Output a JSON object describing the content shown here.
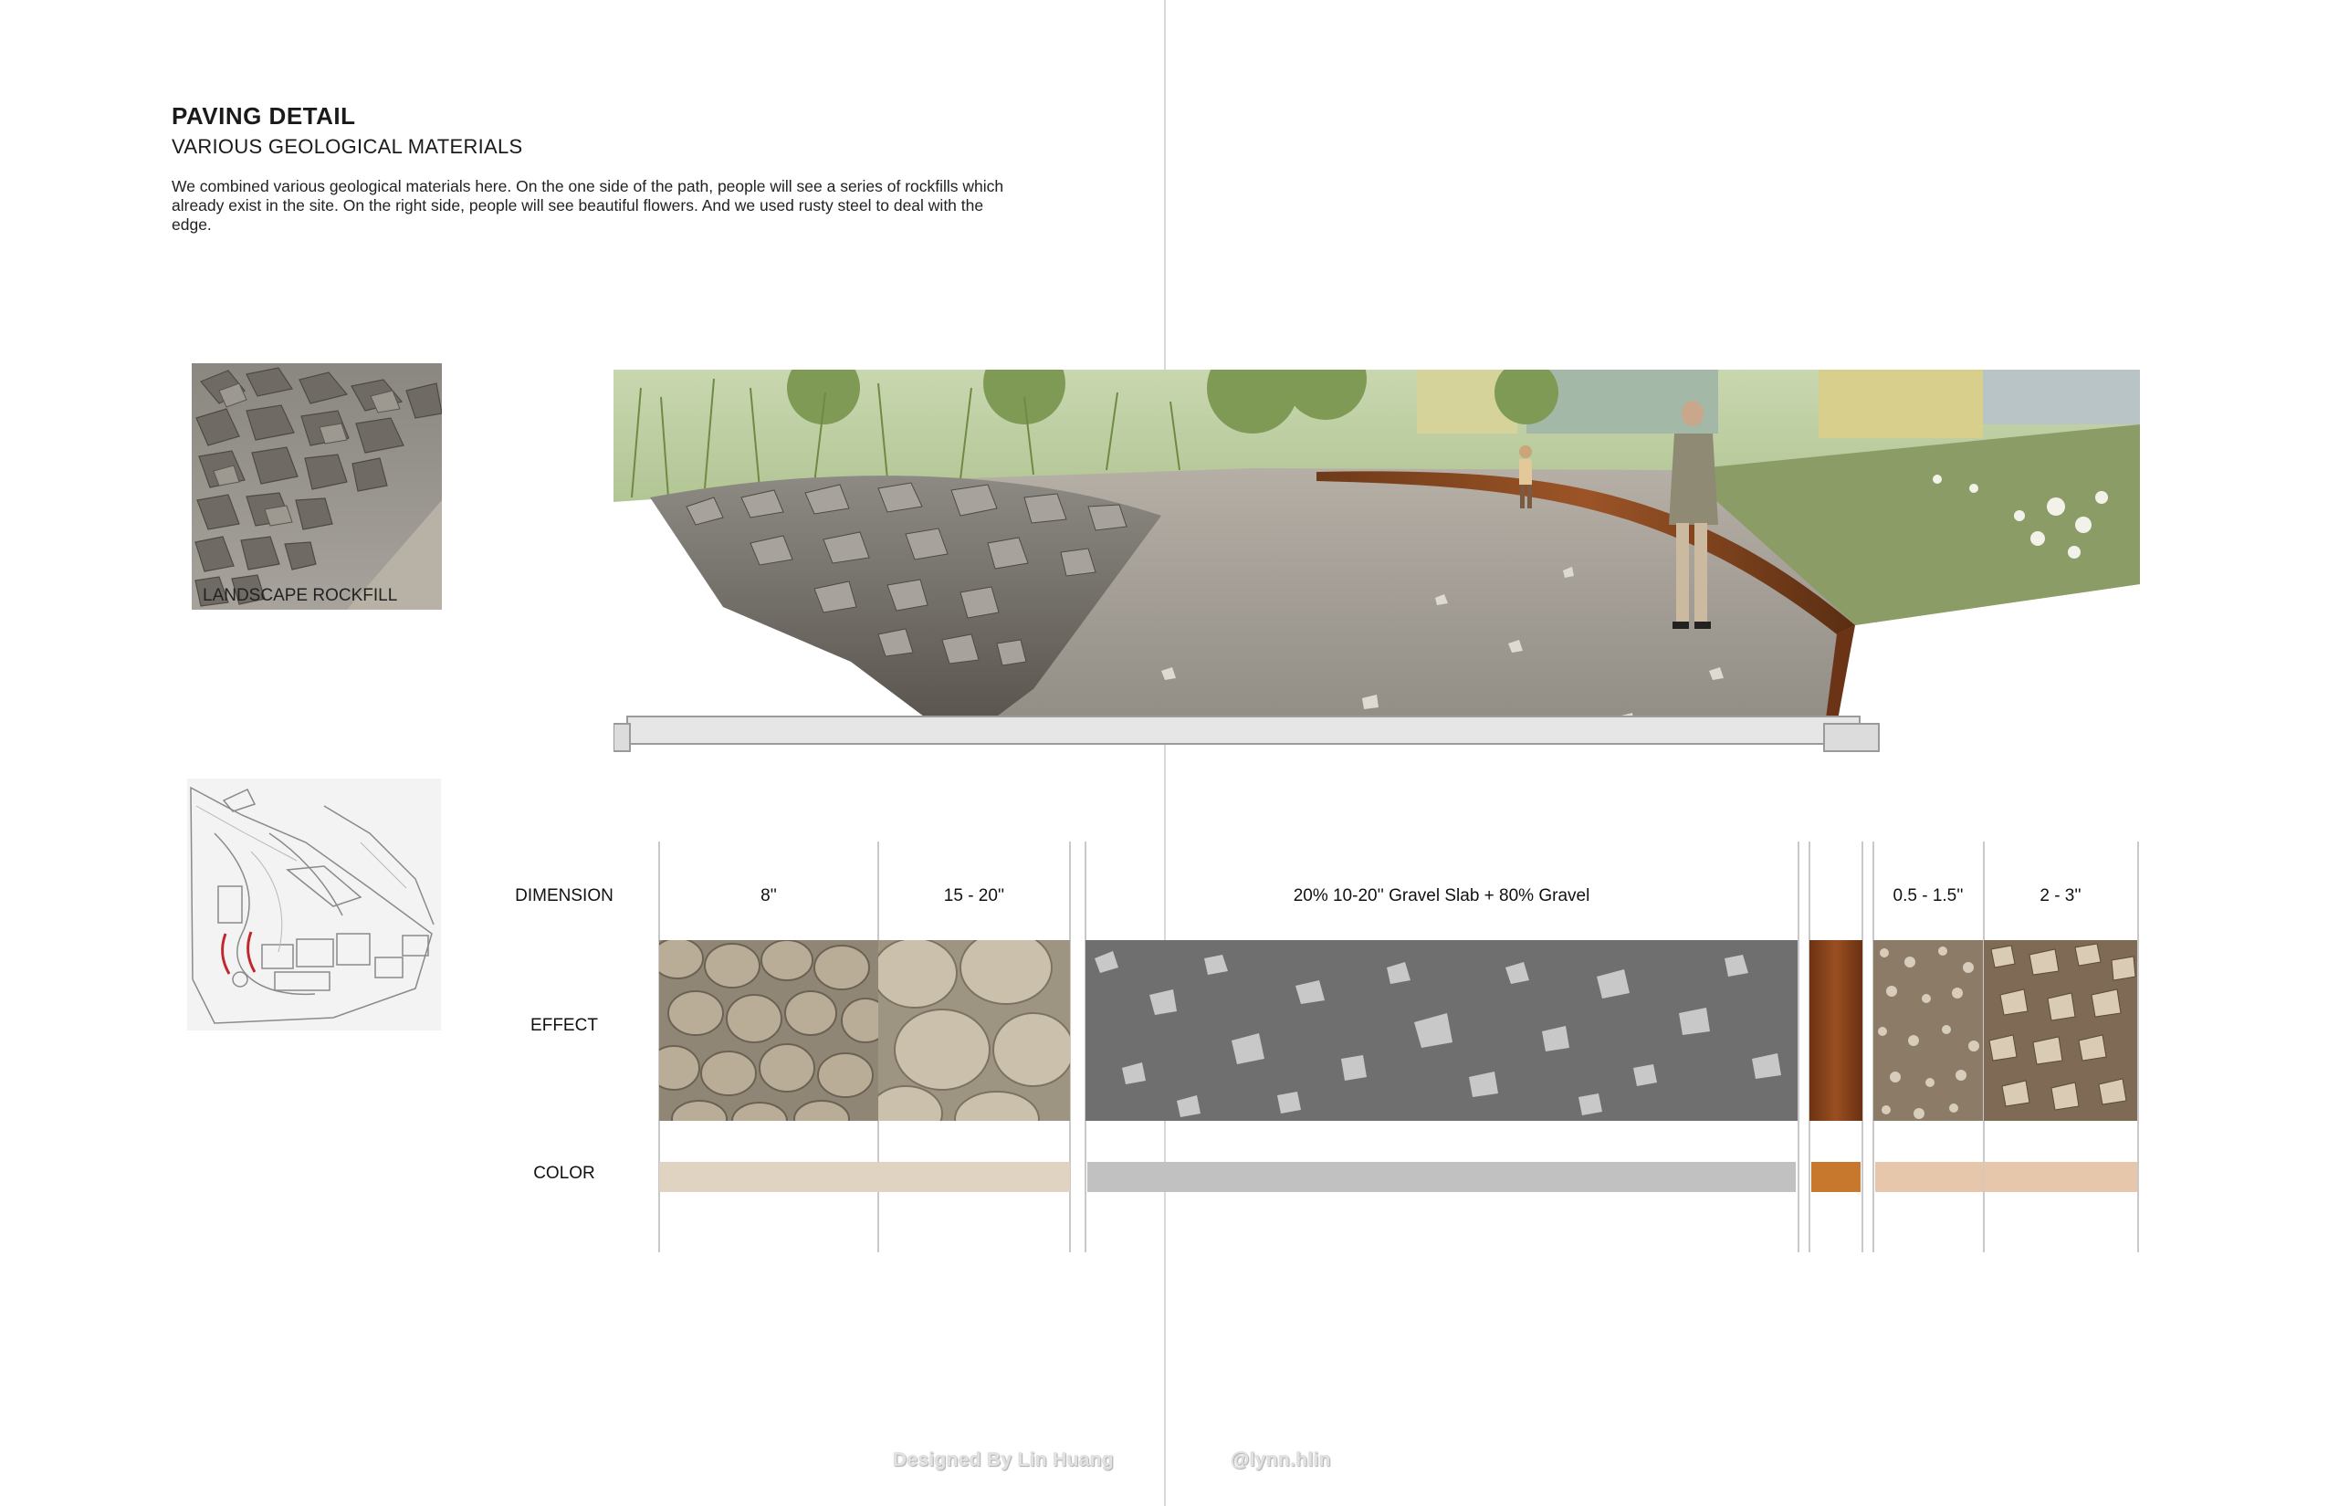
{
  "header": {
    "title": "PAVING DETAIL",
    "subtitle": "VARIOUS GEOLOGICAL MATERIALS",
    "description": "We combined various geological materials here. On the one side of the path, people will see a series of rockfills which already exist in the site. On the right side, people will see beautiful flowers. And we used rusty steel to deal with the edge."
  },
  "thumbnail": {
    "caption": "LANDSCAPE ROCKFILL"
  },
  "table": {
    "row_labels": {
      "dimension": "DIMENSION",
      "effect": "EFFECT",
      "color": "COLOR"
    },
    "columns": [
      {
        "dimension": "8''",
        "effect": "rock-boulders-texture",
        "color": "#e0d3c1"
      },
      {
        "dimension": "15 - 20''",
        "effect": "rock-boulders-large-texture",
        "color": "#e0d3c1"
      },
      {
        "dimension": "20% 10-20'' Gravel Slab + 80% Gravel",
        "effect": "terrazzo-gravel-texture",
        "color": "#c1c1c1"
      },
      {
        "dimension": "",
        "effect": "rusty-steel-texture",
        "color": "#c8782c"
      },
      {
        "dimension": "0.5 - 1.5''",
        "effect": "fine-gravel-texture",
        "color": "#e7c7ab"
      },
      {
        "dimension": "2 - 3''",
        "effect": "coarse-gravel-texture",
        "color": "#e7c7ab"
      }
    ]
  },
  "footer": {
    "credit": "Designed By Lin Huang",
    "handle": "@lynn.hlin"
  }
}
